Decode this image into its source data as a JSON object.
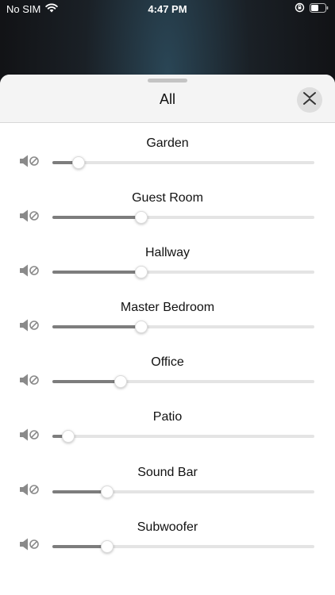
{
  "status_bar": {
    "carrier": "No SIM",
    "time": "4:47 PM",
    "icons": [
      "wifi-icon",
      "orientation-lock-icon",
      "battery-icon"
    ]
  },
  "sheet": {
    "title": "All",
    "collapse_icon": "chevron-collapse-icon"
  },
  "rooms": [
    {
      "name": "Garden",
      "volume": 0.1,
      "icon": "speaker-muted-icon"
    },
    {
      "name": "Guest Room",
      "volume": 0.34,
      "icon": "speaker-muted-icon"
    },
    {
      "name": "Hallway",
      "volume": 0.34,
      "icon": "speaker-muted-icon"
    },
    {
      "name": "Master Bedroom",
      "volume": 0.34,
      "icon": "speaker-muted-icon"
    },
    {
      "name": "Office",
      "volume": 0.26,
      "icon": "speaker-muted-icon"
    },
    {
      "name": "Patio",
      "volume": 0.06,
      "icon": "speaker-muted-icon"
    },
    {
      "name": "Sound Bar",
      "volume": 0.21,
      "icon": "speaker-muted-icon"
    },
    {
      "name": "Subwoofer",
      "volume": 0.21,
      "icon": "speaker-muted-icon"
    }
  ],
  "colors": {
    "slider_fill": "#7d7d7d",
    "slider_track": "#e4e4e4",
    "header_bg": "#f4f4f4"
  }
}
